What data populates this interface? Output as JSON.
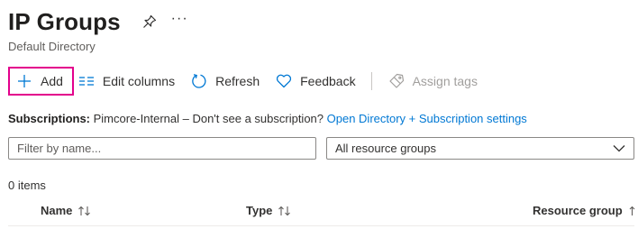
{
  "header": {
    "title": "IP Groups",
    "subtitle": "Default Directory",
    "more_label": "···",
    "icons": {
      "pin": "pin-icon",
      "more": "more-icon"
    }
  },
  "toolbar": {
    "add_label": "Add",
    "edit_columns_label": "Edit columns",
    "refresh_label": "Refresh",
    "feedback_label": "Feedback",
    "assign_tags_label": "Assign tags",
    "icons": {
      "add": "plus-icon",
      "edit_columns": "list-columns-icon",
      "refresh": "refresh-icon",
      "feedback": "heart-icon",
      "assign_tags": "tag-icon"
    },
    "highlight_color": "#e3008c",
    "accent_color": "#0078d4",
    "disabled_color": "#a19f9d"
  },
  "subscriptions": {
    "label": "Subscriptions:",
    "text": " Pimcore-Internal – Don't see a subscription? ",
    "link": "Open Directory + Subscription settings"
  },
  "filters": {
    "filter_placeholder": "Filter by name...",
    "filter_value": "",
    "resource_groups_value": "All resource groups"
  },
  "list": {
    "count": "0 items",
    "columns": [
      "Name",
      "Type",
      "Resource group"
    ]
  }
}
